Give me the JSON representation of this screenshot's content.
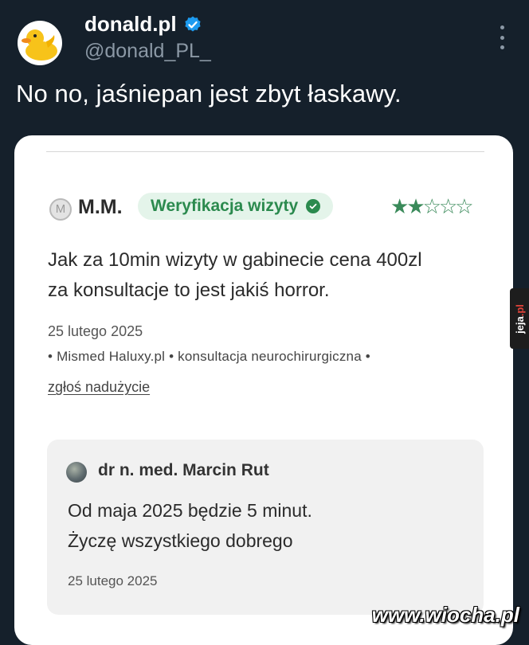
{
  "tweet": {
    "display_name": "donald.pl",
    "handle": "@donald_PL_",
    "text": "No no, jaśniepan jest zbyt łaskawy.",
    "verified_icon": "verified-badge-icon",
    "accent_color": "#1d9bf0"
  },
  "review": {
    "avatar_letter": "M",
    "reviewer": "M.M.",
    "badge": "Weryfikacja wizyty",
    "rating": 2,
    "rating_max": 5,
    "text_line1": "Jak za 10min wizyty w gabinecie cena 400zl",
    "text_line2": "za konsultacje to jest jakiś horror.",
    "date": "25 lutego 2025",
    "meta": "• Mismed Haluxy.pl • konsultacja neurochirurgiczna •",
    "report": "zgłoś nadużycie"
  },
  "reply": {
    "doctor": "dr n. med. Marcin Rut",
    "line1": "Od maja 2025 będzie 5 minut.",
    "line2": "Życzę wszystkiego dobrego",
    "date": "25 lutego 2025"
  },
  "watermarks": {
    "side_a": "jeja",
    "side_b": ".pl",
    "bottom": "www.wiocha.pl"
  },
  "colors": {
    "background": "#15202b",
    "badge_green": "#2b8a4e",
    "star_green": "#3a8a5a"
  }
}
